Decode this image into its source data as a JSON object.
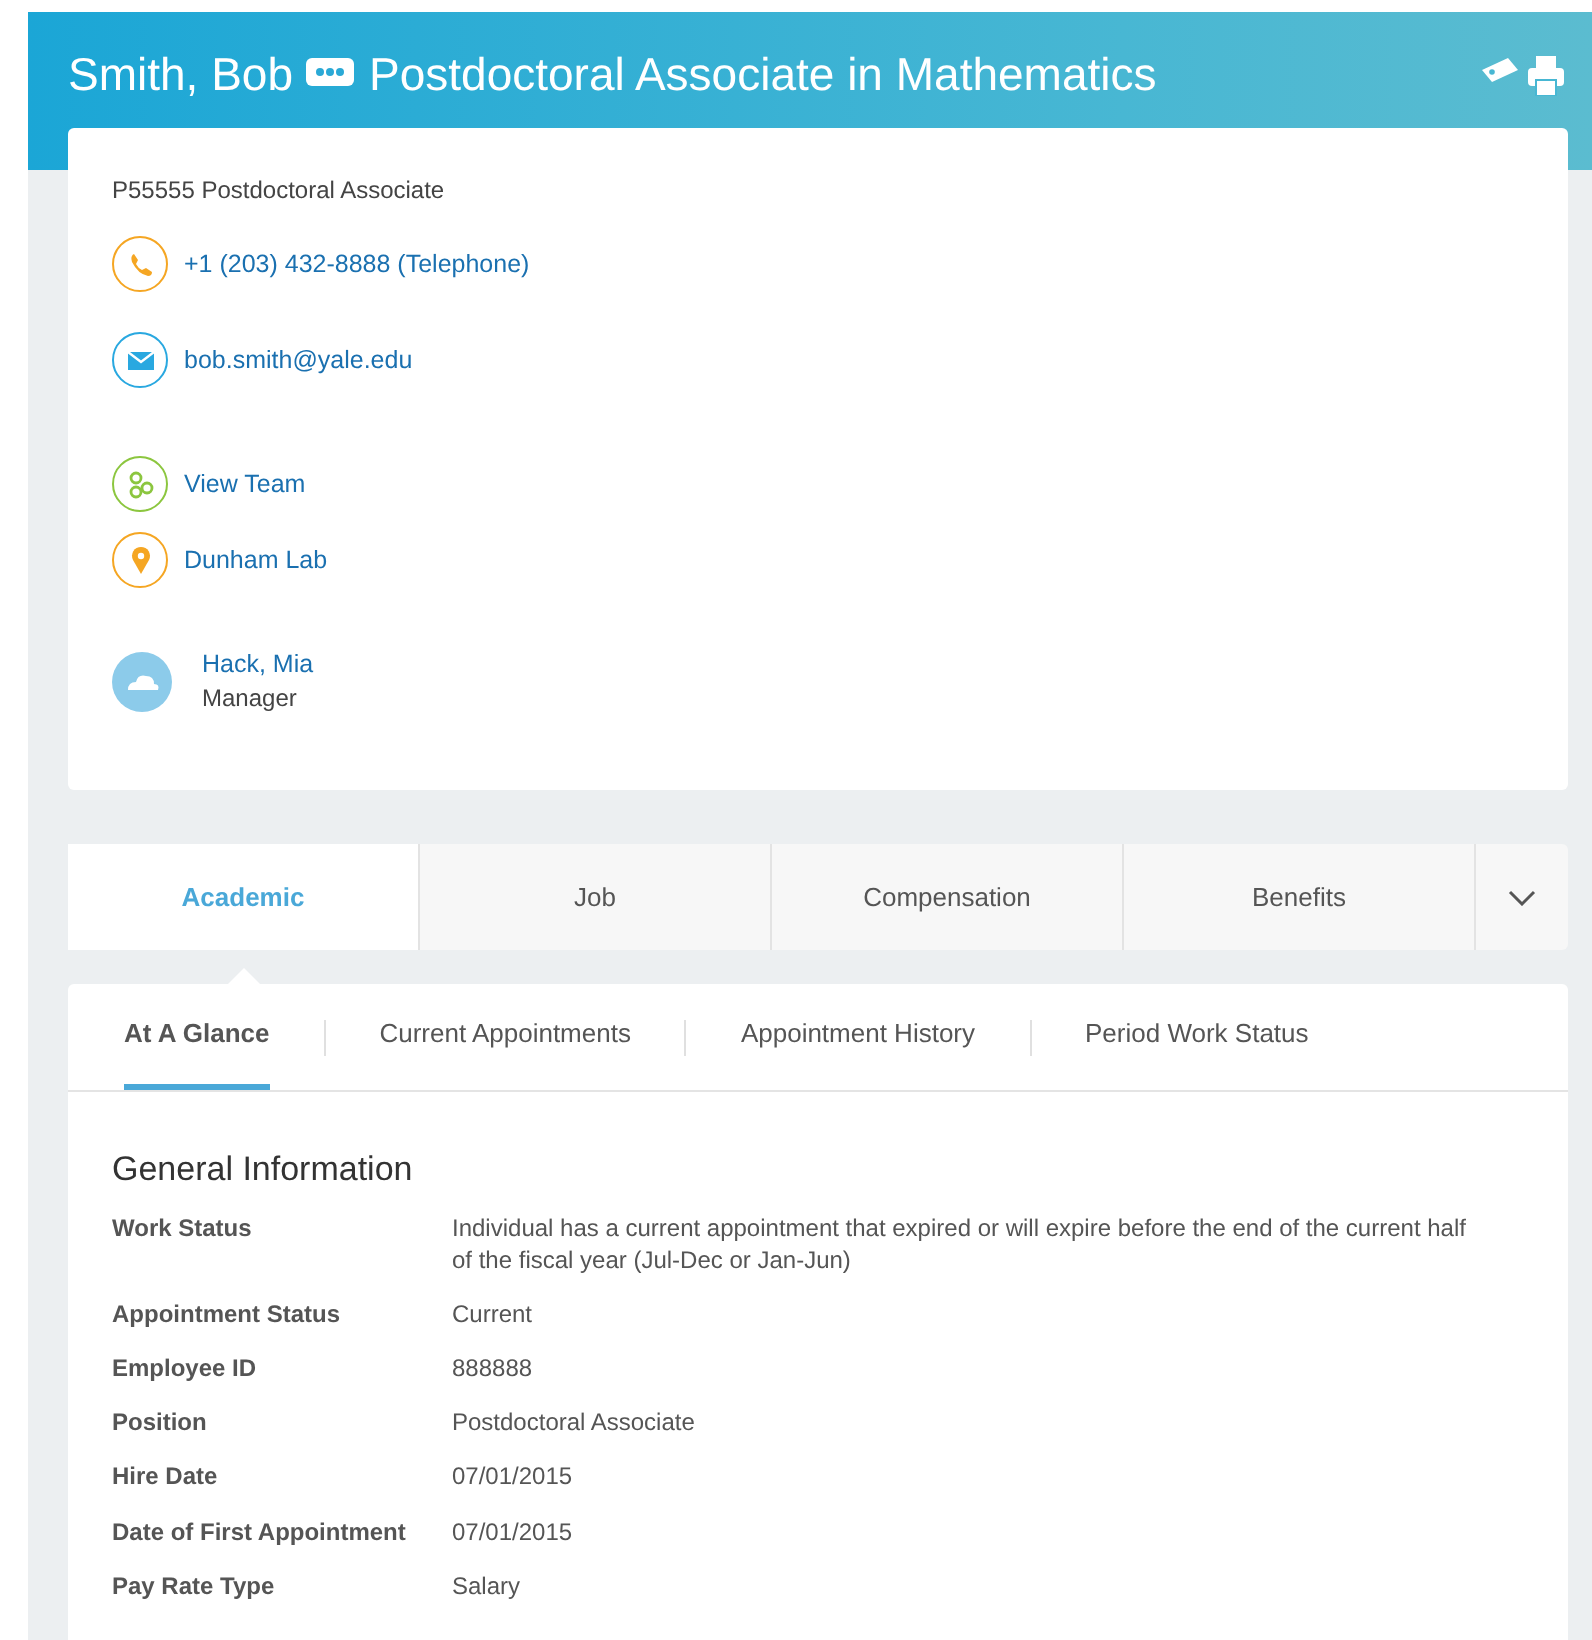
{
  "header": {
    "name": "Smith, Bob",
    "title": "Postdoctoral Associate in Mathematics"
  },
  "profile": {
    "position": "P55555 Postdoctoral Associate",
    "contacts": [
      {
        "kind": "phone",
        "text": "+1 (203) 432-8888 (Telephone)"
      },
      {
        "kind": "email",
        "text": "bob.smith@yale.edu"
      },
      {
        "kind": "team",
        "text": "View Team"
      },
      {
        "kind": "location",
        "text": "Dunham Lab"
      }
    ],
    "manager": {
      "name": "Hack, Mia",
      "role": "Manager"
    }
  },
  "tabs": [
    {
      "label": "Academic",
      "selected": true
    },
    {
      "label": "Job",
      "selected": false
    },
    {
      "label": "Compensation",
      "selected": false
    },
    {
      "label": "Benefits",
      "selected": false
    }
  ],
  "subtabs": [
    {
      "label": "At A Glance",
      "selected": true
    },
    {
      "label": "Current Appointments",
      "selected": false
    },
    {
      "label": "Appointment History",
      "selected": false
    },
    {
      "label": "Period Work Status",
      "selected": false
    }
  ],
  "section": {
    "title": "General Information",
    "fields": [
      {
        "label": "Work Status",
        "value": "Individual has a current appointment that expired or will expire before the end of the current half of the fiscal year (Jul-Dec or Jan-Jun)"
      },
      {
        "label": "Appointment Status",
        "value": "Current"
      },
      {
        "label": "Employee ID",
        "value": "888888"
      },
      {
        "label": "Position",
        "value": "Postdoctoral Associate"
      },
      {
        "label": "Hire Date",
        "value": "07/01/2015"
      },
      {
        "label": "Date of First Appointment",
        "value": "07/01/2015"
      },
      {
        "label": "Pay Rate Type",
        "value": "Salary"
      }
    ]
  }
}
